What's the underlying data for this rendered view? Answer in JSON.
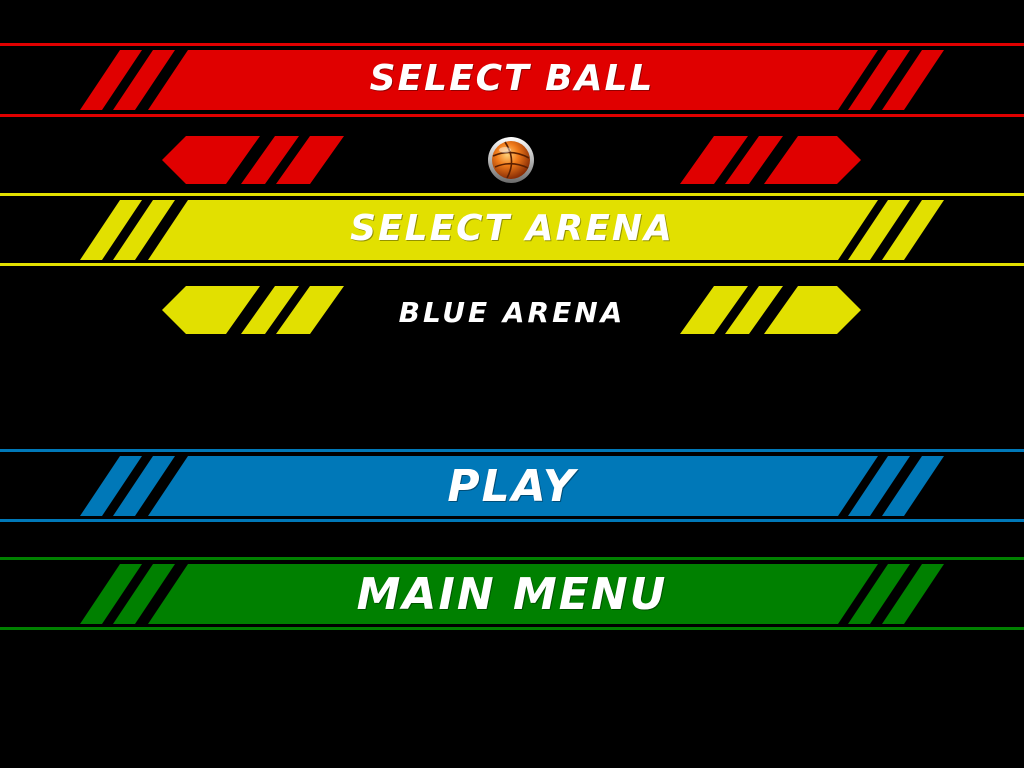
{
  "menu": {
    "select_ball": {
      "label": "SELECT BALL",
      "color": "#e00000"
    },
    "select_arena": {
      "label": "SELECT ARENA",
      "color": "#e2e000"
    },
    "play": {
      "label": "PLAY",
      "color": "#0078b8"
    },
    "main_menu": {
      "label": "MAIN MENU",
      "color": "#008000"
    }
  },
  "ball_selector": {
    "current_ball": "basketball-icon",
    "accent_color": "#e00000"
  },
  "arena_selector": {
    "current_arena": "BLUE ARENA",
    "accent_color": "#e2e000"
  }
}
